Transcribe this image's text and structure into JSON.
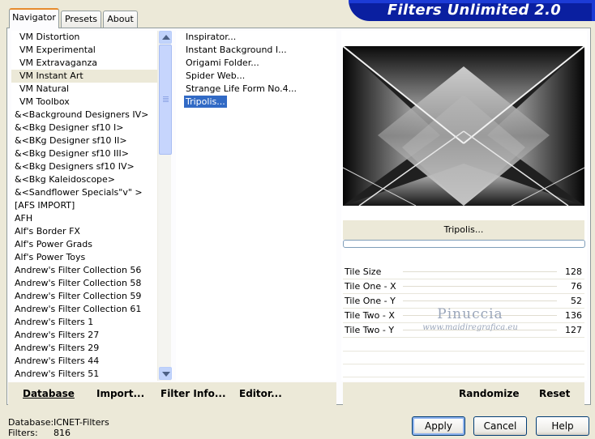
{
  "window": {
    "title": "Filters Unlimited 2.0"
  },
  "tabs": [
    {
      "label": "Navigator",
      "active": true
    },
    {
      "label": "Presets",
      "active": false
    },
    {
      "label": "About",
      "active": false
    }
  ],
  "categories": [
    "VM Distortion",
    "VM Experimental",
    "VM Extravaganza",
    "VM Instant Art",
    "VM Natural",
    "VM Toolbox",
    "&<Background Designers IV>",
    "&<Bkg Designer sf10 I>",
    "&<BKg Designer sf10 II>",
    "&<Bkg Designer sf10 III>",
    "&<Bkg Designers sf10 IV>",
    "&<Bkg Kaleidoscope>",
    "&<Sandflower Specials\"v\" >",
    "[AFS IMPORT]",
    "AFH",
    "Alf's Border FX",
    "Alf's Power Grads",
    "Alf's Power Toys",
    "Andrew's Filter Collection 56",
    "Andrew's Filter Collection 58",
    "Andrew's Filter Collection 59",
    "Andrew's Filter Collection 61",
    "Andrew's Filters 1",
    "Andrew's Filters 27",
    "Andrew's Filters 29",
    "Andrew's Filters 44",
    "Andrew's Filters 51"
  ],
  "selected_category": "VM Instant Art",
  "filters": [
    "Inspirator...",
    "Instant Background I...",
    "Origami Folder...",
    "Spider Web...",
    "Strange Life Form No.4...",
    "Tripolis..."
  ],
  "selected_filter": "Tripolis...",
  "preview": {
    "filter_name": "Tripolis...",
    "progress": 0
  },
  "parameters": [
    {
      "name": "Tile Size",
      "value": "128"
    },
    {
      "name": "Tile One - X",
      "value": "76"
    },
    {
      "name": "Tile One - Y",
      "value": "52"
    },
    {
      "name": "Tile Two - X",
      "value": "136"
    },
    {
      "name": "Tile Two - Y",
      "value": "127"
    }
  ],
  "watermark": {
    "line1": "Pinuccia",
    "line2": "www.maidiregrafica.eu"
  },
  "toolbar": {
    "database": "Database",
    "import": "Import...",
    "filter_info": "Filter Info...",
    "editor": "Editor...",
    "randomize": "Randomize",
    "reset": "Reset"
  },
  "info": {
    "database_label": "Database:",
    "database_value": "ICNET-Filters",
    "filters_label": "Filters:",
    "filters_value": "816"
  },
  "buttons": {
    "apply": "Apply",
    "cancel": "Cancel",
    "help": "Help"
  },
  "colors": {
    "title_bar": "#0a1fa0",
    "selection": "#316ac5",
    "tab_accent": "#e68b2c"
  }
}
